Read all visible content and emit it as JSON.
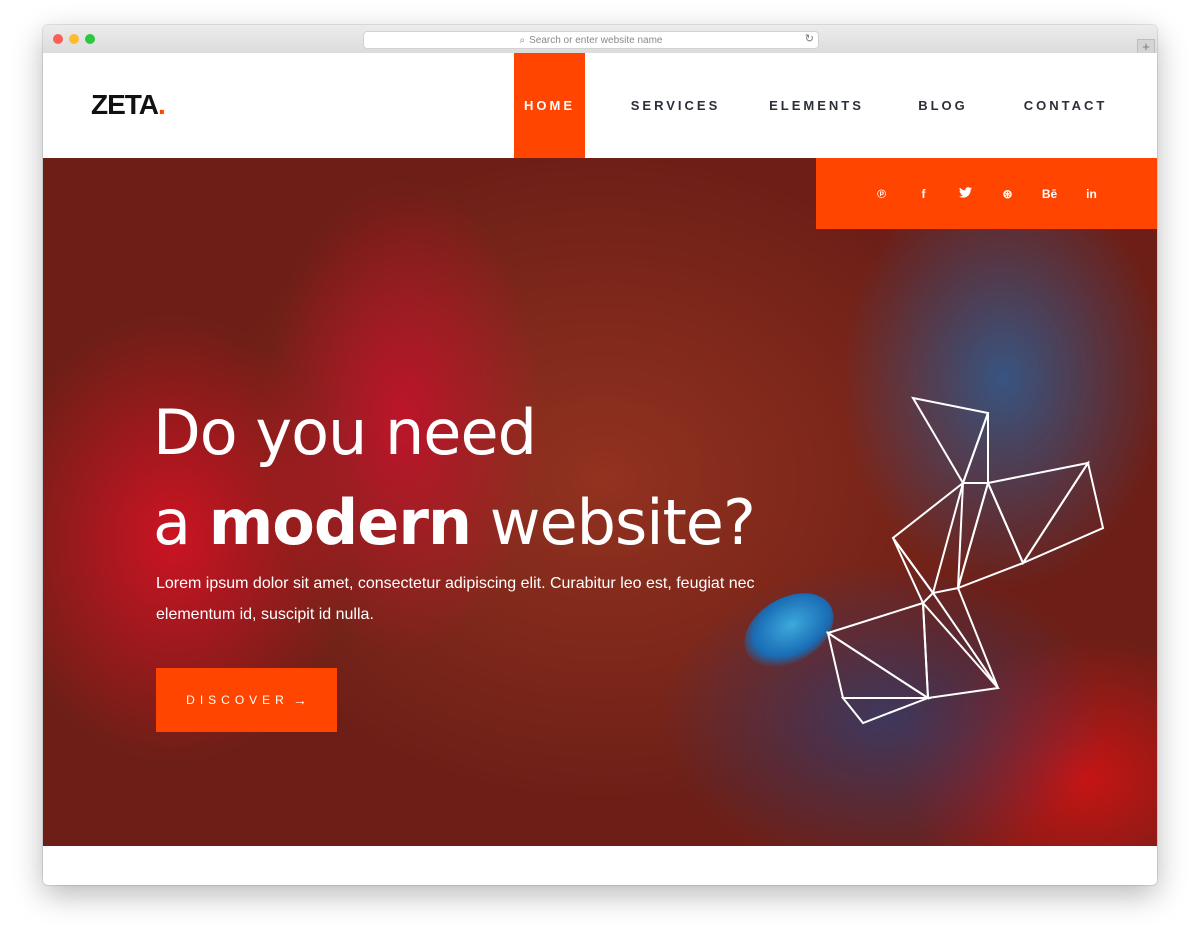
{
  "browser": {
    "address_placeholder": "Search or enter website name"
  },
  "logo": {
    "text": "ZETA",
    "dot": "."
  },
  "nav": {
    "items": [
      {
        "label": "HOME",
        "active": true
      },
      {
        "label": "SERVICES",
        "active": false
      },
      {
        "label": "ELEMENTS",
        "active": false
      },
      {
        "label": "BLOG",
        "active": false
      },
      {
        "label": "CONTACT",
        "active": false
      }
    ]
  },
  "social": {
    "icons": [
      "pinterest-icon",
      "facebook-icon",
      "twitter-icon",
      "dribbble-icon",
      "behance-icon",
      "linkedin-icon"
    ],
    "glyphs": [
      "℗",
      "f",
      "🐦",
      "⊛",
      "Bē",
      "in"
    ]
  },
  "hero": {
    "title_line1": "Do you need",
    "title_line2_pre": "a ",
    "title_line2_bold": "modern",
    "title_line2_post": " website?",
    "text": "Lorem ipsum dolor sit amet, consectetur adipiscing elit. Curabitur leo est, feugiat nec elementum id, suscipit id nulla.",
    "button_label": "DISCOVER",
    "button_arrow": "→"
  },
  "colors": {
    "accent": "#ff4500",
    "nav_text": "#2b2f3a"
  }
}
